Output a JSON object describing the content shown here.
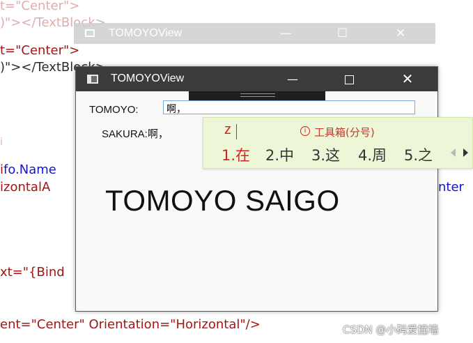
{
  "editor": {
    "line1": "t=\"Center\">",
    "line2": ")\"></TextBlock>",
    "line3": "t=\"Center\">",
    "line4": ")\"></TextBlock>",
    "line5a": "fo.Name",
    "line6a": "izontalA",
    "line6b": "nter",
    "line7a": "xt=\"{Bind",
    "line8": "ent=\"Center\" Orientation=\"Horizontal\"/>"
  },
  "ghost_window": {
    "title": "TOMOYOView"
  },
  "window": {
    "title": "TOMOYOView",
    "tomoyo_label": "TOMOYO:",
    "tomoyo_value": "啊，",
    "sakura_label": "SAKURA:啊，",
    "big_text": "TOMOYO SAIGO"
  },
  "ime": {
    "composition": "z",
    "hint": "工具箱(分号)",
    "candidates": [
      "1.在",
      "2.中",
      "3.这",
      "4.周",
      "5.之"
    ]
  },
  "watermark": "CSDN @小码爱撞墙",
  "colors": {
    "titlebar": "#3b3b3b",
    "ime_bg": "#eef6d8",
    "ime_red": "#d62020",
    "xaml_red": "#a31515",
    "xaml_blue": "#1515c8"
  }
}
